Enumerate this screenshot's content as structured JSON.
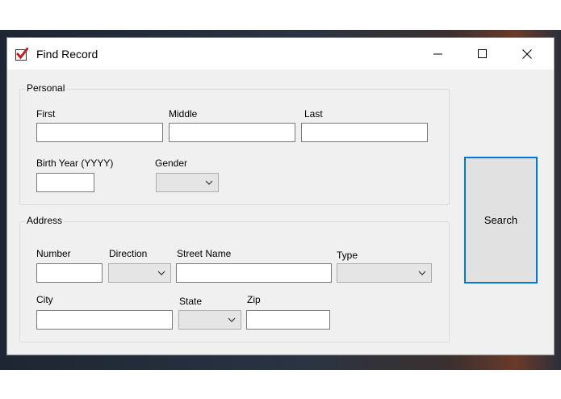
{
  "window": {
    "title": "Find Record",
    "icon": "checkbox-red-check-icon",
    "controls": {
      "minimize": "minimize-icon",
      "maximize": "maximize-icon",
      "close": "close-icon"
    }
  },
  "personal": {
    "legend": "Personal",
    "first_label": "First",
    "first_value": "",
    "middle_label": "Middle",
    "middle_value": "",
    "last_label": "Last",
    "last_value": "",
    "birth_year_label": "Birth Year (YYYY)",
    "birth_year_value": "",
    "gender_label": "Gender",
    "gender_value": ""
  },
  "address": {
    "legend": "Address",
    "number_label": "Number",
    "number_value": "",
    "direction_label": "Direction",
    "direction_value": "",
    "street_name_label": "Street Name",
    "street_name_value": "",
    "type_label": "Type",
    "type_value": "",
    "city_label": "City",
    "city_value": "",
    "state_label": "State",
    "state_value": "",
    "zip_label": "Zip",
    "zip_value": ""
  },
  "search_button": {
    "label": "Search"
  },
  "colors": {
    "accent": "#0078d7",
    "icon_check": "#c41e1e",
    "window_bg": "#f0f0f0",
    "titlebar_bg": "#ffffff"
  }
}
